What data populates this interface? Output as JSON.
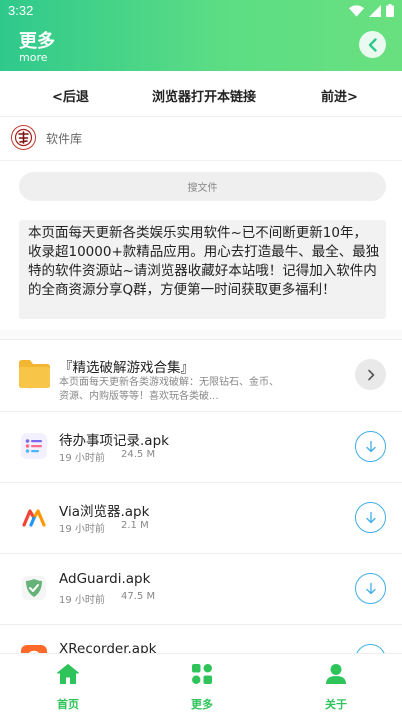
{
  "status_bar": {
    "time": "3:32"
  },
  "header": {
    "title": "更多",
    "subtitle": "more"
  },
  "nav": {
    "back": "<后退",
    "open_in_browser": "浏览器打开本链接",
    "forward": "前进>"
  },
  "site": {
    "name": "软件库"
  },
  "search": {
    "placeholder": "搜文件"
  },
  "notice": {
    "text": "本页面每天更新各类娱乐实用软件~已不间断更新10年，收录超10000+款精品应用。用心去打造最牛、最全、最独特的软件资源站~请浏览器收藏好本站哦！记得加入软件内的全商资源分享Q群，方便第一时间获取更多福利！"
  },
  "folder": {
    "title": "『精选破解游戏合集』",
    "description": "本页面每天更新各类游戏破解：无限钻石、金币、资源、内购版等等！喜欢玩各类破..."
  },
  "files": [
    {
      "name": "待办事项记录.apk",
      "time": "19 小时前",
      "size": "24.5 M",
      "icon": "todo-list-icon"
    },
    {
      "name": "Via浏览器.apk",
      "time": "19 小时前",
      "size": "2.1 M",
      "icon": "via-browser-icon"
    },
    {
      "name": "AdGuardi.apk",
      "time": "19 小时前",
      "size": "47.5 M",
      "icon": "adguard-shield-icon"
    },
    {
      "name": "XRecorder.apk",
      "time": "",
      "size": "",
      "icon": "xrecorder-icon"
    }
  ],
  "bottom_nav": {
    "home": "首页",
    "more": "更多",
    "about": "关于"
  },
  "colors": {
    "accent_green": "#2fc45a",
    "header_gradient_start": "#2fc98c",
    "header_gradient_end": "#69e080",
    "download_blue": "#41aee8"
  }
}
